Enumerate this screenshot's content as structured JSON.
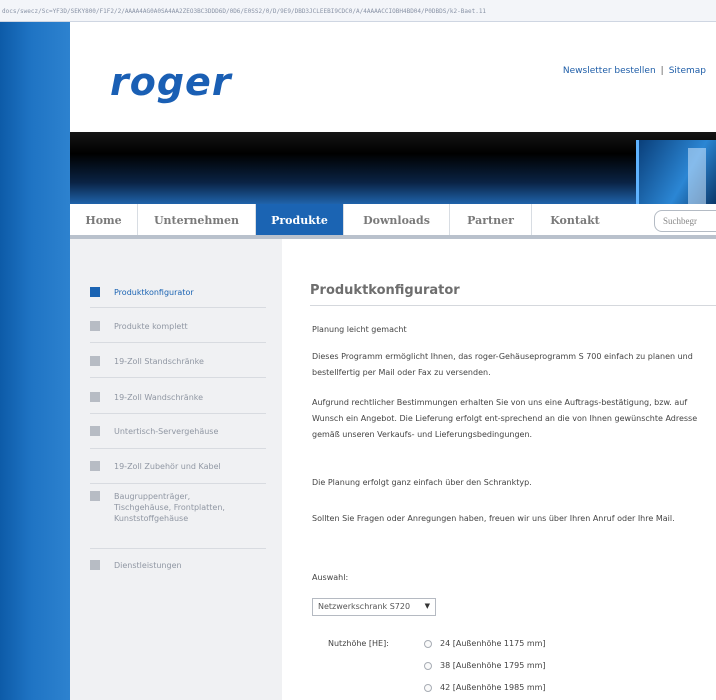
{
  "browser": {
    "url": "docs/swecz/Sc=YF3D/SEKY800/F1F2/2/AAAA4AG0A0SA4AA2ZEO3BC3DDD6D/0D6/E0SS2/0/D/9E9/DBD3JCLEEBI9CDC0/A/4AAAACCIOBH4BD04/P0DBDS/k2-Baet.11"
  },
  "header": {
    "logo": "roger",
    "links": [
      "Newsletter bestellen",
      "Sitemap"
    ],
    "separator": "|"
  },
  "nav": {
    "items": [
      "Home",
      "Unternehmen",
      "Produkte",
      "Downloads",
      "Partner",
      "Kontakt"
    ],
    "active_index": 2,
    "search_placeholder": "Suchbegr"
  },
  "sidebar": {
    "items": [
      {
        "label": "Produktkonfigurator",
        "active": true
      },
      {
        "label": "Produkte komplett",
        "active": false
      },
      {
        "label": "19-Zoll Standschränke",
        "active": false
      },
      {
        "label": "19-Zoll Wandschränke",
        "active": false
      },
      {
        "label": "Untertisch-Servergehäuse",
        "active": false
      },
      {
        "label": "19-Zoll Zubehör und Kabel",
        "active": false
      },
      {
        "label": "Baugruppenträger, Tischgehäuse, Frontplatten, Kunststoffgehäuse",
        "active": false
      },
      {
        "label": "Dienstleistungen",
        "active": false
      }
    ]
  },
  "main": {
    "title": "Produktkonfigurator",
    "paragraphs": [
      "Planung leicht gemacht",
      "Dieses Programm ermöglicht Ihnen, das roger-Gehäuseprogramm S 700 einfach zu planen und bestellfertig per Mail oder Fax zu versenden.",
      "Aufgrund rechtlicher Bestimmungen erhalten Sie von uns eine Auftrags-bestätigung, bzw. auf Wunsch ein Angebot. Die Lieferung erfolgt ent-sprechend an die von Ihnen gewünschte Adresse gemäß unseren Verkaufs- und Lieferungsbedingungen.",
      "Die Planung erfolgt ganz einfach über den Schranktyp.",
      "Sollten Sie Fragen oder Anregungen haben, freuen wir uns über Ihren Anruf oder Ihre Mail."
    ],
    "auswahl_label": "Auswahl:",
    "select_value": "Netzwerkschrank S720",
    "nutzhoehe_label": "Nutzhöhe [HE]:",
    "radio_options": [
      "24  [Außenhöhe 1175 mm]",
      "38  [Außenhöhe 1795 mm]",
      "42  [Außenhöhe 1985 mm]"
    ]
  }
}
